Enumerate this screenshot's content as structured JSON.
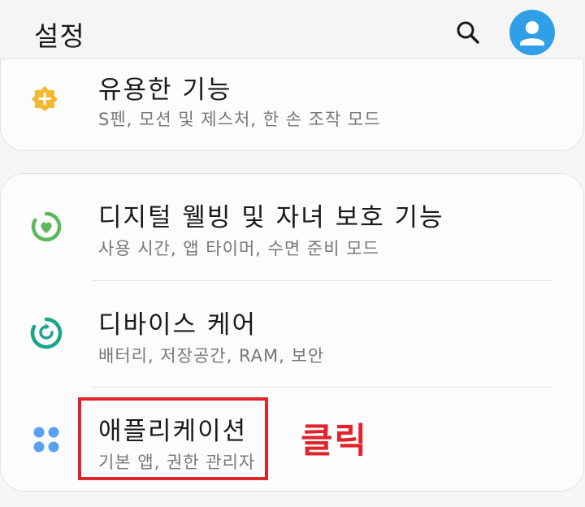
{
  "header": {
    "title": "설정",
    "search_icon": "search-icon",
    "avatar_icon": "user-avatar-icon",
    "avatar_color": "#2fa0e8"
  },
  "top_card": {
    "title_partial": "유용한 기능",
    "subtitle": "S펜, 모션 및 제스처, 한 손 조작 모드",
    "icon": "plus-badge-icon",
    "icon_color": "#f5b931"
  },
  "items": [
    {
      "title": "디지털 웰빙 및 자녀 보호 기능",
      "subtitle": "사용 시간, 앱 타이머, 수면 준비 모드",
      "icon": "digital-wellbeing-icon",
      "icon_color": "#5cb85c"
    },
    {
      "title": "디바이스 케어",
      "subtitle": "배터리, 저장공간, RAM, 보안",
      "icon": "device-care-icon",
      "icon_color": "#1aa68a"
    },
    {
      "title": "애플리케이션",
      "subtitle": "기본 앱, 권한 관리자",
      "icon": "apps-grid-icon",
      "icon_color": "#5b9ff0"
    }
  ],
  "annotation": {
    "text": "클릭",
    "color": "#e0242c"
  }
}
